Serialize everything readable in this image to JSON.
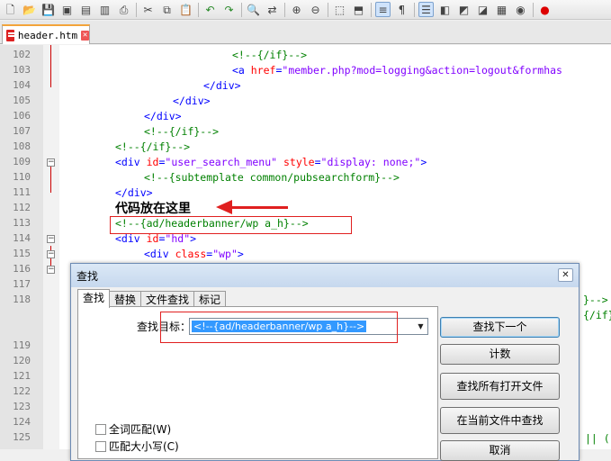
{
  "tab": {
    "filename": "header.htm",
    "close": "✕"
  },
  "lines": [
    {
      "n": "102"
    },
    {
      "n": "103"
    },
    {
      "n": "104"
    },
    {
      "n": "105"
    },
    {
      "n": "106"
    },
    {
      "n": "107"
    },
    {
      "n": "108"
    },
    {
      "n": "109"
    },
    {
      "n": "110"
    },
    {
      "n": "111"
    },
    {
      "n": "112"
    },
    {
      "n": "113"
    },
    {
      "n": "114"
    },
    {
      "n": "115"
    },
    {
      "n": "116"
    },
    {
      "n": "117"
    },
    {
      "n": "118"
    },
    {
      "n": "119"
    },
    {
      "n": "120"
    },
    {
      "n": "121"
    },
    {
      "n": "122"
    },
    {
      "n": "123"
    },
    {
      "n": "124"
    },
    {
      "n": "125"
    }
  ],
  "code": {
    "l102": "<!--{/if}-->",
    "l103_open": "<a ",
    "l103_attr": "href",
    "l103_eq": "=",
    "l103_val": "\"member.php?mod=logging&action=logout&formhas",
    "l104": "</div>",
    "l105": "</div>",
    "l106": "</div>",
    "l107": "<!--{/if}-->",
    "l108": "<!--{/if}-->",
    "l109_tag": "<div ",
    "l109_attr1": "id",
    "l109_val1": "\"user_search_menu\"",
    "l109_attr2": "style",
    "l109_val2": "\"display: none;\"",
    "l109_end": ">",
    "l110": "<!--{subtemplate common/pubsearchform}-->",
    "l111": "</div>",
    "l113": "<!--{ad/headerbanner/wp a_h}-->",
    "l114_tag": "<div ",
    "l114_attr": "id",
    "l114_val": "\"hd\"",
    "l114_end": ">",
    "l115_tag": "<div ",
    "l115_attr": "class",
    "l115_val": "\"wp\"",
    "l115_end": ">",
    "l118_tail1": "}-->",
    "l118_tail2": "{/if}",
    "l125_tail": "|| ("
  },
  "annotation": "代码放在这里",
  "dialog": {
    "title": "查找",
    "close": "✕",
    "tabs": [
      "查找",
      "替换",
      "文件查找",
      "标记"
    ],
    "find_label": "查找目标：",
    "find_value": "<!--{ad/headerbanner/wp a_h}-->",
    "buttons": {
      "find_next": "查找下一个",
      "count": "计数",
      "find_all_open": "查找所有打开文件",
      "find_in_current": "在当前文件中查找",
      "cancel": "取消"
    },
    "options": {
      "whole_word": "全词匹配(W)",
      "match_case": "匹配大小写(C)"
    }
  },
  "colors": {
    "comment": "#008000",
    "tag": "#0000ff",
    "attribute": "#ff0000",
    "value": "#8000ff",
    "marker": "#e02020"
  }
}
